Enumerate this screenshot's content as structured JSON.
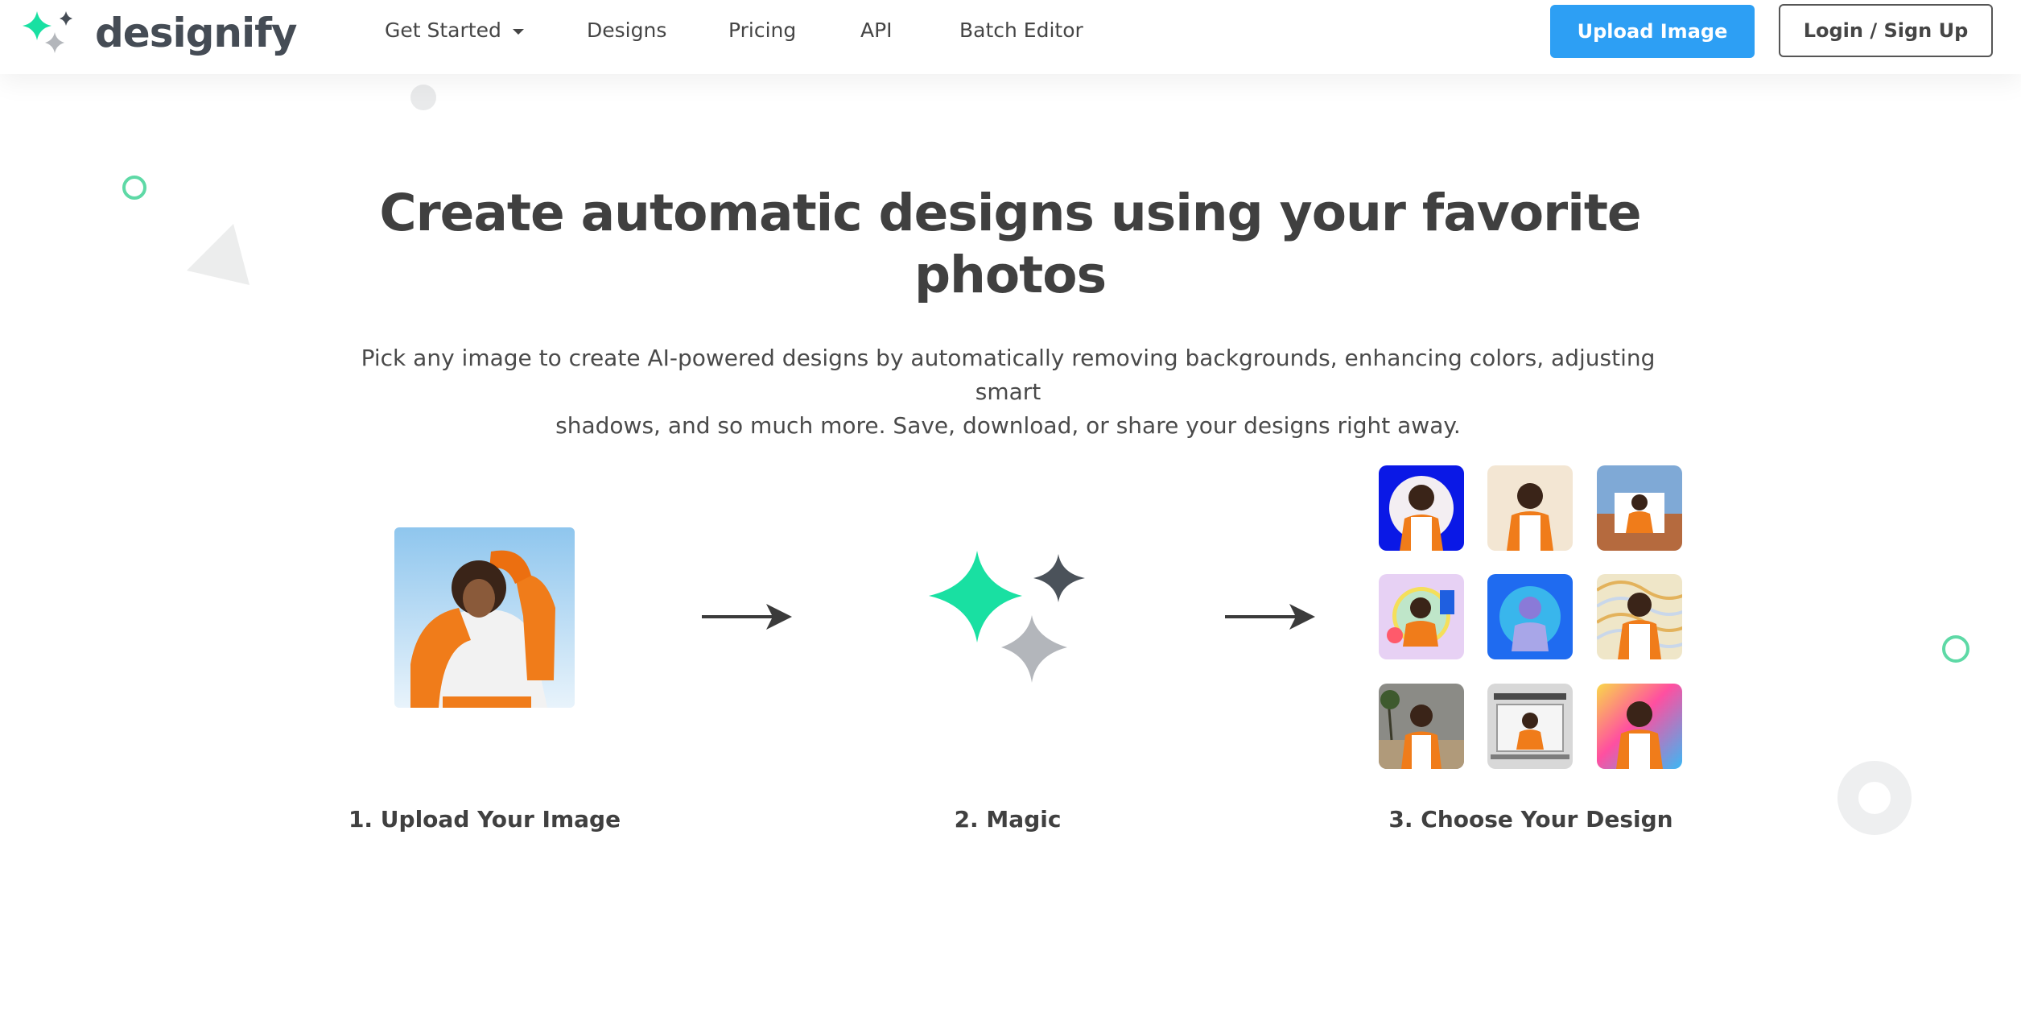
{
  "brand": {
    "name": "designify",
    "accent": "#19e0a2",
    "icon": "sparkles-logo-icon"
  },
  "nav": {
    "items": [
      "Get Started",
      "Designs",
      "Pricing",
      "API",
      "Batch Editor"
    ],
    "dropdown_icon": "chevron-down-icon"
  },
  "actions": {
    "upload_label": "Upload Image",
    "login_label": "Login / Sign Up",
    "upload_color": "#2d9ff4"
  },
  "hero": {
    "title_line1": "Create automatic designs using your favorite",
    "title_line2": "photos",
    "subtitle_line1": "Pick any image to create AI-powered designs by automatically removing backgrounds, enhancing colors, adjusting smart",
    "subtitle_line2": "shadows, and so much more. Save, download, or share your designs right away."
  },
  "steps": {
    "step1": "1. Upload Your Image",
    "step2": "2. Magic",
    "step3": "3. Choose Your Design"
  },
  "design_thumbnails": [
    "blue-wavy-frame-design",
    "beige-background-design",
    "beach-framed-design",
    "sticker-collage-design",
    "blue-circle-design",
    "striped-pattern-design",
    "palm-beach-design",
    "laptop-mockup-design",
    "gradient-rainbow-design"
  ]
}
